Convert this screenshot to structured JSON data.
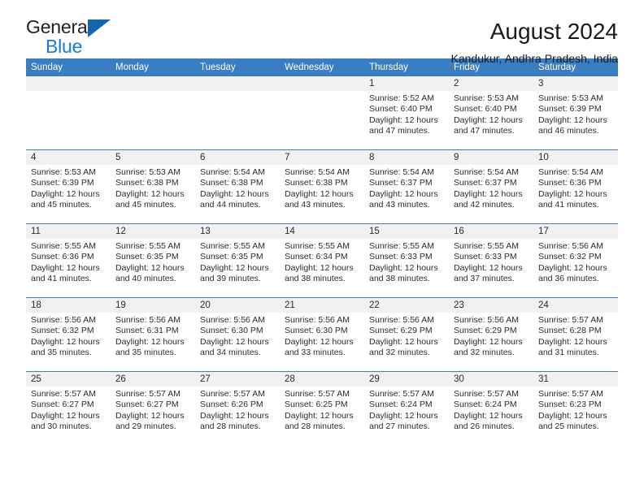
{
  "brand": {
    "name_top": "General",
    "name_bottom": "Blue",
    "triangle_color": "#1566ab",
    "blue_text_color": "#1b7ccd"
  },
  "header": {
    "title": "August 2024",
    "subtitle": "Kandukur, Andhra Pradesh, India"
  },
  "theme": {
    "header_row_bg": "#3a7dc0",
    "daynum_bg": "#f1f1f1",
    "grid_line": "#3a7dc0"
  },
  "weekdays": [
    "Sunday",
    "Monday",
    "Tuesday",
    "Wednesday",
    "Thursday",
    "Friday",
    "Saturday"
  ],
  "weeks": [
    [
      {
        "day": "",
        "sunrise": "",
        "sunset": "",
        "daylight": "",
        "empty": true
      },
      {
        "day": "",
        "sunrise": "",
        "sunset": "",
        "daylight": "",
        "empty": true
      },
      {
        "day": "",
        "sunrise": "",
        "sunset": "",
        "daylight": "",
        "empty": true
      },
      {
        "day": "",
        "sunrise": "",
        "sunset": "",
        "daylight": "",
        "empty": true
      },
      {
        "day": "1",
        "sunrise": "Sunrise: 5:52 AM",
        "sunset": "Sunset: 6:40 PM",
        "daylight": "Daylight: 12 hours and 47 minutes."
      },
      {
        "day": "2",
        "sunrise": "Sunrise: 5:53 AM",
        "sunset": "Sunset: 6:40 PM",
        "daylight": "Daylight: 12 hours and 47 minutes."
      },
      {
        "day": "3",
        "sunrise": "Sunrise: 5:53 AM",
        "sunset": "Sunset: 6:39 PM",
        "daylight": "Daylight: 12 hours and 46 minutes."
      }
    ],
    [
      {
        "day": "4",
        "sunrise": "Sunrise: 5:53 AM",
        "sunset": "Sunset: 6:39 PM",
        "daylight": "Daylight: 12 hours and 45 minutes."
      },
      {
        "day": "5",
        "sunrise": "Sunrise: 5:53 AM",
        "sunset": "Sunset: 6:38 PM",
        "daylight": "Daylight: 12 hours and 45 minutes."
      },
      {
        "day": "6",
        "sunrise": "Sunrise: 5:54 AM",
        "sunset": "Sunset: 6:38 PM",
        "daylight": "Daylight: 12 hours and 44 minutes."
      },
      {
        "day": "7",
        "sunrise": "Sunrise: 5:54 AM",
        "sunset": "Sunset: 6:38 PM",
        "daylight": "Daylight: 12 hours and 43 minutes."
      },
      {
        "day": "8",
        "sunrise": "Sunrise: 5:54 AM",
        "sunset": "Sunset: 6:37 PM",
        "daylight": "Daylight: 12 hours and 43 minutes."
      },
      {
        "day": "9",
        "sunrise": "Sunrise: 5:54 AM",
        "sunset": "Sunset: 6:37 PM",
        "daylight": "Daylight: 12 hours and 42 minutes."
      },
      {
        "day": "10",
        "sunrise": "Sunrise: 5:54 AM",
        "sunset": "Sunset: 6:36 PM",
        "daylight": "Daylight: 12 hours and 41 minutes."
      }
    ],
    [
      {
        "day": "11",
        "sunrise": "Sunrise: 5:55 AM",
        "sunset": "Sunset: 6:36 PM",
        "daylight": "Daylight: 12 hours and 41 minutes."
      },
      {
        "day": "12",
        "sunrise": "Sunrise: 5:55 AM",
        "sunset": "Sunset: 6:35 PM",
        "daylight": "Daylight: 12 hours and 40 minutes."
      },
      {
        "day": "13",
        "sunrise": "Sunrise: 5:55 AM",
        "sunset": "Sunset: 6:35 PM",
        "daylight": "Daylight: 12 hours and 39 minutes."
      },
      {
        "day": "14",
        "sunrise": "Sunrise: 5:55 AM",
        "sunset": "Sunset: 6:34 PM",
        "daylight": "Daylight: 12 hours and 38 minutes."
      },
      {
        "day": "15",
        "sunrise": "Sunrise: 5:55 AM",
        "sunset": "Sunset: 6:33 PM",
        "daylight": "Daylight: 12 hours and 38 minutes."
      },
      {
        "day": "16",
        "sunrise": "Sunrise: 5:55 AM",
        "sunset": "Sunset: 6:33 PM",
        "daylight": "Daylight: 12 hours and 37 minutes."
      },
      {
        "day": "17",
        "sunrise": "Sunrise: 5:56 AM",
        "sunset": "Sunset: 6:32 PM",
        "daylight": "Daylight: 12 hours and 36 minutes."
      }
    ],
    [
      {
        "day": "18",
        "sunrise": "Sunrise: 5:56 AM",
        "sunset": "Sunset: 6:32 PM",
        "daylight": "Daylight: 12 hours and 35 minutes."
      },
      {
        "day": "19",
        "sunrise": "Sunrise: 5:56 AM",
        "sunset": "Sunset: 6:31 PM",
        "daylight": "Daylight: 12 hours and 35 minutes."
      },
      {
        "day": "20",
        "sunrise": "Sunrise: 5:56 AM",
        "sunset": "Sunset: 6:30 PM",
        "daylight": "Daylight: 12 hours and 34 minutes."
      },
      {
        "day": "21",
        "sunrise": "Sunrise: 5:56 AM",
        "sunset": "Sunset: 6:30 PM",
        "daylight": "Daylight: 12 hours and 33 minutes."
      },
      {
        "day": "22",
        "sunrise": "Sunrise: 5:56 AM",
        "sunset": "Sunset: 6:29 PM",
        "daylight": "Daylight: 12 hours and 32 minutes."
      },
      {
        "day": "23",
        "sunrise": "Sunrise: 5:56 AM",
        "sunset": "Sunset: 6:29 PM",
        "daylight": "Daylight: 12 hours and 32 minutes."
      },
      {
        "day": "24",
        "sunrise": "Sunrise: 5:57 AM",
        "sunset": "Sunset: 6:28 PM",
        "daylight": "Daylight: 12 hours and 31 minutes."
      }
    ],
    [
      {
        "day": "25",
        "sunrise": "Sunrise: 5:57 AM",
        "sunset": "Sunset: 6:27 PM",
        "daylight": "Daylight: 12 hours and 30 minutes."
      },
      {
        "day": "26",
        "sunrise": "Sunrise: 5:57 AM",
        "sunset": "Sunset: 6:27 PM",
        "daylight": "Daylight: 12 hours and 29 minutes."
      },
      {
        "day": "27",
        "sunrise": "Sunrise: 5:57 AM",
        "sunset": "Sunset: 6:26 PM",
        "daylight": "Daylight: 12 hours and 28 minutes."
      },
      {
        "day": "28",
        "sunrise": "Sunrise: 5:57 AM",
        "sunset": "Sunset: 6:25 PM",
        "daylight": "Daylight: 12 hours and 28 minutes."
      },
      {
        "day": "29",
        "sunrise": "Sunrise: 5:57 AM",
        "sunset": "Sunset: 6:24 PM",
        "daylight": "Daylight: 12 hours and 27 minutes."
      },
      {
        "day": "30",
        "sunrise": "Sunrise: 5:57 AM",
        "sunset": "Sunset: 6:24 PM",
        "daylight": "Daylight: 12 hours and 26 minutes."
      },
      {
        "day": "31",
        "sunrise": "Sunrise: 5:57 AM",
        "sunset": "Sunset: 6:23 PM",
        "daylight": "Daylight: 12 hours and 25 minutes."
      }
    ]
  ]
}
